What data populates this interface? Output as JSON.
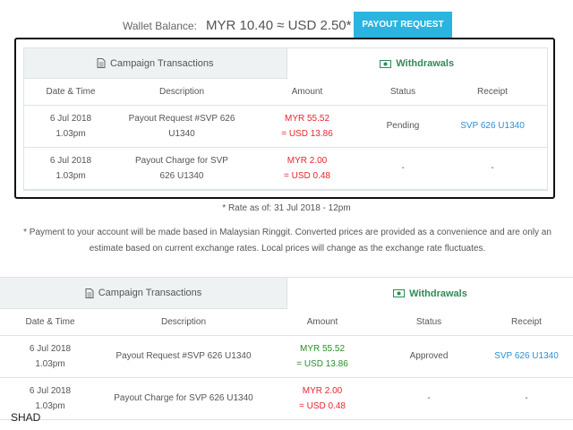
{
  "wallet": {
    "label": "Wallet Balance:",
    "value": "MYR 10.40 ≈ USD 2.50*",
    "payout_button": "PAYOUT REQUEST"
  },
  "top_panel": {
    "tabs": {
      "campaign": "Campaign Transactions",
      "withdrawals": "Withdrawals"
    },
    "headers": [
      "Date & Time",
      "Description",
      "Amount",
      "Status",
      "Receipt"
    ],
    "rows": [
      {
        "date": "6 Jul 2018",
        "time": "1.03pm",
        "description": "Payout Request #SVP 626 U1340",
        "amount_myr": "MYR 55.52",
        "amount_usd": "= USD 13.86",
        "status": "Pending",
        "receipt": "SVP 626 U1340"
      },
      {
        "date": "6 Jul 2018",
        "time": "1.03pm",
        "description": "Payout Charge for SVP 626 U1340",
        "amount_myr": "MYR 2.00",
        "amount_usd": "= USD 0.48",
        "status": "-",
        "receipt": "-"
      }
    ]
  },
  "rate_note": "* Rate as of: 31 Jul 2018 - 12pm",
  "disclaimer": "* Payment to your account will be made based in Malaysian Ringgit. Converted prices are provided as a convenience and are only an estimate based on current exchange rates. Local prices will change as the exchange rate fluctuates.",
  "bottom_panel": {
    "tabs": {
      "campaign": "Campaign Transactions",
      "withdrawals": "Withdrawals"
    },
    "headers": [
      "Date & Time",
      "Description",
      "Amount",
      "Status",
      "Receipt"
    ],
    "rows": [
      {
        "date": "6 Jul 2018",
        "time": "1.03pm",
        "description": "Payout Request #SVP 626 U1340",
        "amount_myr": "MYR 55.52",
        "amount_usd": "= USD 13.86",
        "status": "Approved",
        "receipt": "SVP 626 U1340"
      },
      {
        "date": "6 Jul 2018",
        "time": "1.03pm",
        "description": "Payout Charge for SVP 626 U1340",
        "amount_myr": "MYR 2.00",
        "amount_usd": "= USD 0.48",
        "status": "-",
        "receipt": "-"
      }
    ]
  },
  "footer_label": "SHAD",
  "colors": {
    "accent": "#2bb4e0",
    "tab_active": "#2e8b57",
    "amount_red": "#e8242e",
    "amount_green": "#2a8c2a",
    "link": "#2b8fd6"
  },
  "icons": {
    "campaign_tab": "document-icon",
    "withdrawals_tab": "money-icon"
  }
}
